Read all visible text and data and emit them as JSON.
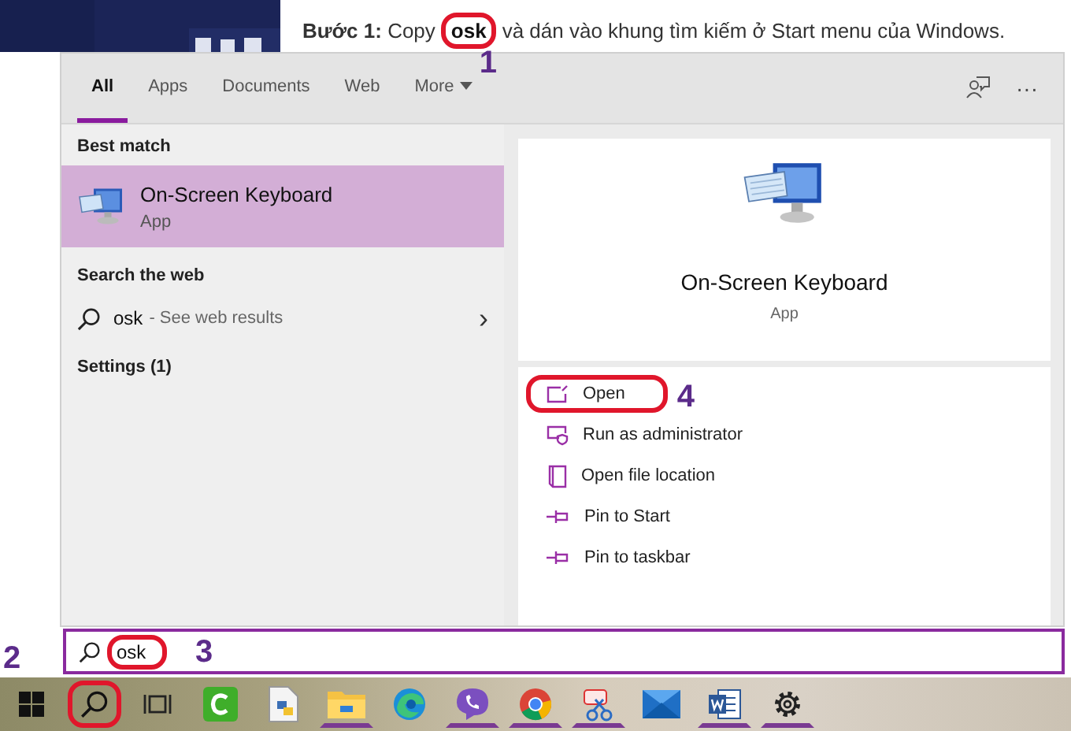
{
  "article": {
    "lead": "**Bước 1:** Copy",
    "keyword": {
      "text": "osk",
      "circled": true,
      "callout": "1"
    },
    "rest": "và dán vào khung tìm kiếm ở Start menu của Windows."
  },
  "tabs": [
    {
      "label": "All",
      "selected": true,
      "kind": "tab"
    },
    {
      "label": "Apps",
      "selected": false,
      "kind": "tab"
    },
    {
      "label": "Documents",
      "selected": false,
      "kind": "tab"
    },
    {
      "label": "Web",
      "selected": false,
      "kind": "tab"
    },
    {
      "label": "More",
      "selected": false,
      "kind": "menu"
    }
  ],
  "header_actions": [
    {
      "kind": "feedback"
    },
    {
      "kind": "more",
      "label": "···"
    }
  ],
  "results": {
    "best_match_heading": "Best match",
    "best_match": {
      "name": "On-Screen Keyboard",
      "type": "App",
      "selected": true
    },
    "web_heading": "Search the web",
    "web_result": {
      "query": "osk",
      "hint": "- See web results",
      "chevron": "›"
    },
    "settings_heading": "Settings (1)"
  },
  "preview": {
    "name": "On-Screen Keyboard",
    "type": "App",
    "actions": [
      {
        "label": "Open",
        "kind": "open",
        "circled": true,
        "callout": "4"
      },
      {
        "label": "Run as administrator",
        "kind": "shield",
        "circled": false
      },
      {
        "label": "Open file location",
        "kind": "folder",
        "circled": false
      },
      {
        "label": "Pin to Start",
        "kind": "pin",
        "circled": false
      },
      {
        "label": "Pin to taskbar",
        "kind": "pin",
        "circled": false
      }
    ]
  },
  "search_box": {
    "value": "osk",
    "circled": true,
    "callout": "3"
  },
  "taskbar": {
    "items": [
      {
        "kind": "windows",
        "running": false,
        "circled": false
      },
      {
        "kind": "search",
        "running": false,
        "circled": true,
        "callout": "2"
      },
      {
        "kind": "taskview",
        "running": false,
        "circled": false
      },
      {
        "kind": "camtasia",
        "running": false,
        "circled": false
      },
      {
        "kind": "pyfile",
        "running": false,
        "circled": false
      },
      {
        "kind": "folder",
        "running": true,
        "circled": false
      },
      {
        "kind": "edge",
        "running": false,
        "circled": false
      },
      {
        "kind": "viber",
        "running": true,
        "circled": false
      },
      {
        "kind": "chrome",
        "running": true,
        "circled": false
      },
      {
        "kind": "snip",
        "running": true,
        "circled": false
      },
      {
        "kind": "mail",
        "running": false,
        "circled": false
      },
      {
        "kind": "word",
        "running": true,
        "circled": false
      },
      {
        "kind": "gear",
        "running": true,
        "circled": false
      }
    ]
  }
}
